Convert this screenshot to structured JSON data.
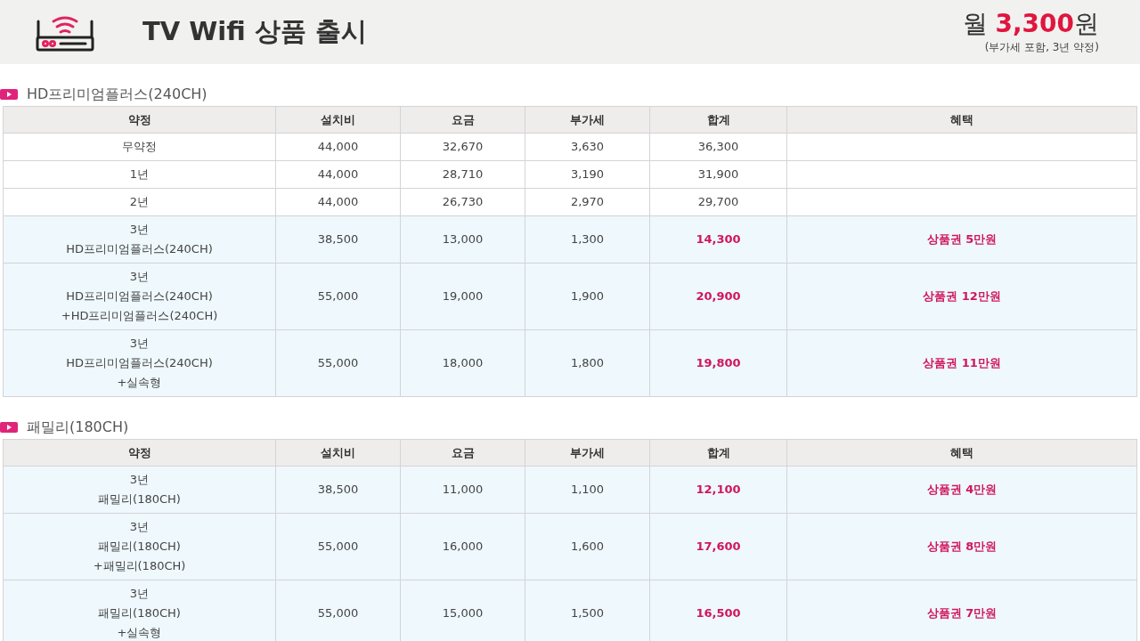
{
  "banner": {
    "title": "TV Wifi 상품 출시",
    "price_prefix": "월",
    "price": "3,300",
    "price_suffix": "원",
    "price_note": "(부가세 포함, 3년 약정)"
  },
  "sections": [
    {
      "title": "HD프리미엄플러스(240CH)",
      "columns": [
        "약정",
        "설치비",
        "요금",
        "부가세",
        "합계",
        "혜택"
      ],
      "rows": [
        {
          "highlighted": false,
          "contract": "무약정",
          "install": "44,000",
          "fee": "32,670",
          "vat": "3,630",
          "total": "36,300",
          "benefit": ""
        },
        {
          "highlighted": false,
          "contract": "1년",
          "install": "44,000",
          "fee": "28,710",
          "vat": "3,190",
          "total": "31,900",
          "benefit": ""
        },
        {
          "highlighted": false,
          "contract": "2년",
          "install": "44,000",
          "fee": "26,730",
          "vat": "2,970",
          "total": "29,700",
          "benefit": ""
        },
        {
          "highlighted": true,
          "contract": "3년\nHD프리미엄플러스(240CH)",
          "install": "38,500",
          "fee": "13,000",
          "vat": "1,300",
          "total": "14,300",
          "benefit": "상품권 5만원"
        },
        {
          "highlighted": true,
          "contract": "3년\nHD프리미엄플러스(240CH)\n+HD프리미엄플러스(240CH)",
          "install": "55,000",
          "fee": "19,000",
          "vat": "1,900",
          "total": "20,900",
          "benefit": "상품권 12만원"
        },
        {
          "highlighted": true,
          "contract": "3년\nHD프리미엄플러스(240CH)\n+실속형",
          "install": "55,000",
          "fee": "18,000",
          "vat": "1,800",
          "total": "19,800",
          "benefit": "상품권 11만원"
        }
      ]
    },
    {
      "title": "패밀리(180CH)",
      "columns": [
        "약정",
        "설치비",
        "요금",
        "부가세",
        "합계",
        "혜택"
      ],
      "rows": [
        {
          "highlighted": true,
          "contract": "3년\n패밀리(180CH)",
          "install": "38,500",
          "fee": "11,000",
          "vat": "1,100",
          "total": "12,100",
          "benefit": "상품권 4만원"
        },
        {
          "highlighted": true,
          "contract": "3년\n패밀리(180CH)\n+패밀리(180CH)",
          "install": "55,000",
          "fee": "16,000",
          "vat": "1,600",
          "total": "17,600",
          "benefit": "상품권 8만원"
        },
        {
          "highlighted": true,
          "contract": "3년\n패밀리(180CH)\n+실속형",
          "install": "55,000",
          "fee": "15,000",
          "vat": "1,500",
          "total": "16,500",
          "benefit": "상품권 7만원"
        }
      ]
    }
  ]
}
